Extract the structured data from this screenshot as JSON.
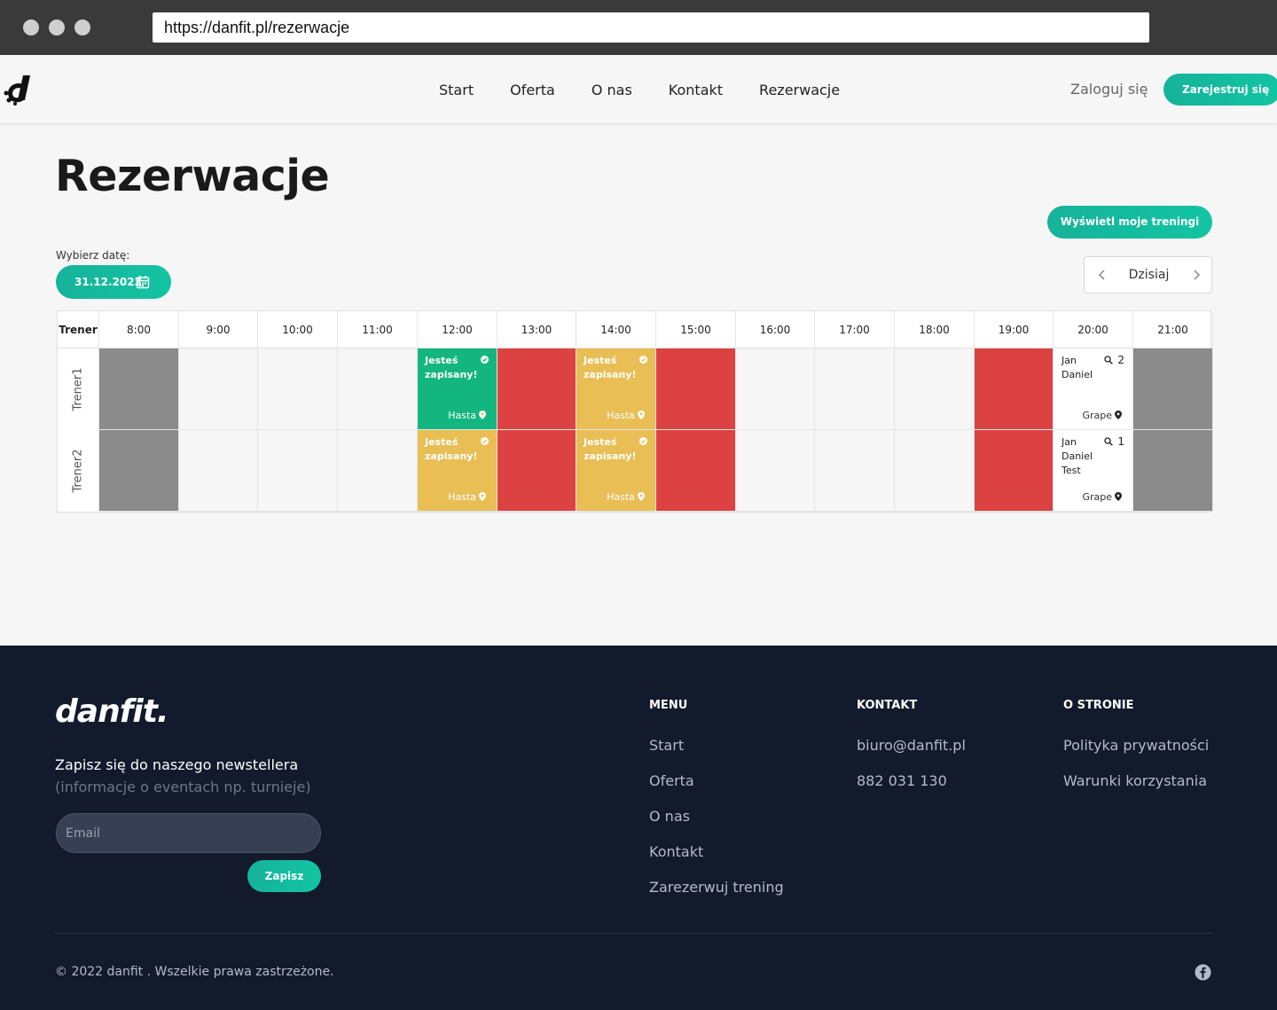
{
  "browser": {
    "url": "https://danfit.pl/rezerwacje"
  },
  "nav": {
    "links": [
      "Start",
      "Oferta",
      "O nas",
      "Kontakt",
      "Rezerwacje"
    ],
    "login": "Zaloguj się",
    "register": "Zarejestruj się"
  },
  "main": {
    "title": "Rezerwacje",
    "my_trainings": "Wyświetl moje treningi",
    "date_label": "Wybierz datę:",
    "date_value": "31.12.2022",
    "today": "Dzisiaj"
  },
  "schedule": {
    "trainer_header": "Trener",
    "hours": [
      "8:00",
      "9:00",
      "10:00",
      "11:00",
      "12:00",
      "13:00",
      "14:00",
      "15:00",
      "16:00",
      "17:00",
      "18:00",
      "19:00",
      "20:00",
      "21:00"
    ],
    "rows": [
      {
        "trainer": "Trener1",
        "cells": [
          {
            "type": "gray"
          },
          {
            "type": "empty"
          },
          {
            "type": "empty"
          },
          {
            "type": "empty"
          },
          {
            "type": "green",
            "status": "Jesteś zapisany!",
            "place": "Hasta"
          },
          {
            "type": "red"
          },
          {
            "type": "yellow",
            "status": "Jesteś zapisany!",
            "place": "Hasta"
          },
          {
            "type": "red"
          },
          {
            "type": "empty"
          },
          {
            "type": "empty"
          },
          {
            "type": "empty"
          },
          {
            "type": "red"
          },
          {
            "type": "white",
            "names": [
              "Jan",
              "Daniel"
            ],
            "count": "2",
            "place": "Grape"
          },
          {
            "type": "gray"
          }
        ]
      },
      {
        "trainer": "Trener2",
        "cells": [
          {
            "type": "gray"
          },
          {
            "type": "empty"
          },
          {
            "type": "empty"
          },
          {
            "type": "empty"
          },
          {
            "type": "yellow",
            "status": "Jesteś zapisany!",
            "place": "Hasta"
          },
          {
            "type": "red"
          },
          {
            "type": "yellow",
            "status": "Jesteś zapisany!",
            "place": "Hasta"
          },
          {
            "type": "red"
          },
          {
            "type": "empty"
          },
          {
            "type": "empty"
          },
          {
            "type": "empty"
          },
          {
            "type": "red"
          },
          {
            "type": "white",
            "names": [
              "Jan",
              "Daniel",
              "Test"
            ],
            "count": "1",
            "place": "Grape"
          },
          {
            "type": "gray"
          }
        ]
      }
    ]
  },
  "footer": {
    "logo": "danfit.",
    "newsletter_title": "Zapisz się do naszego newstellera",
    "newsletter_sub": "(informacje o eventach np. turnieje)",
    "email_placeholder": "Email",
    "subscribe": "Zapisz",
    "menu": {
      "head": "MENU",
      "items": [
        "Start",
        "Oferta",
        "O nas",
        "Kontakt",
        "Zarezerwuj trening"
      ]
    },
    "contact": {
      "head": "KONTAKT",
      "items": [
        "biuro@danfit.pl",
        "882 031 130"
      ]
    },
    "about": {
      "head": "O STRONIE",
      "items": [
        "Polityka prywatności",
        "Warunki korzystania"
      ]
    },
    "copyright": "© 2022 danfit . Wszelkie prawa zastrzeżone."
  },
  "icons": {
    "logo": "danfit-d-logo-icon",
    "calendar": "calendar-icon",
    "prev": "chevron-left-icon",
    "next": "chevron-right-icon",
    "check": "check-circle-icon",
    "pin": "map-pin-icon",
    "search": "search-icon",
    "facebook": "facebook-icon"
  },
  "colors": {
    "accent": "#13c4a3",
    "booked_green": "#14b67f",
    "booked_yellow": "#e8be55",
    "full_red": "#dc4242",
    "unavailable_gray": "#8b8b8b",
    "footer_bg": "#121a2c"
  }
}
